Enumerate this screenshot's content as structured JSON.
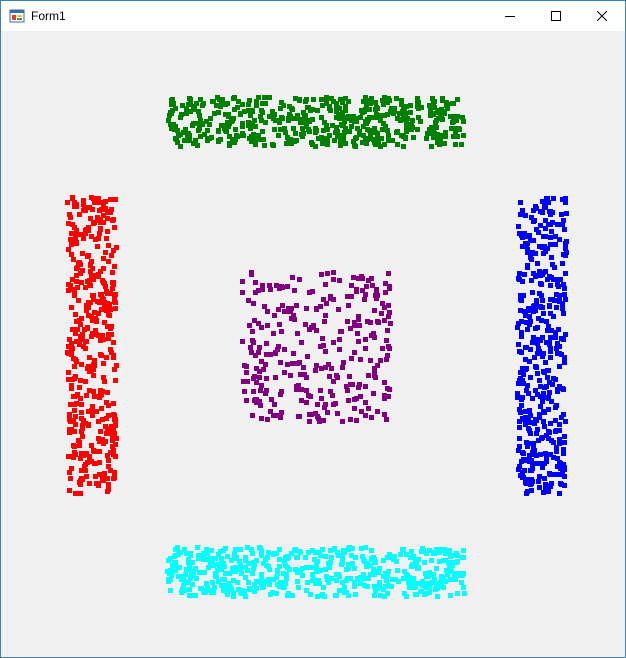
{
  "window": {
    "title": "Form1"
  },
  "caption_buttons": {
    "minimize_icon": "minimize-icon",
    "maximize_icon": "maximize-icon",
    "close_icon": "close-icon"
  },
  "clusters": [
    {
      "name": "green-cluster",
      "color": "#008000",
      "count": 520
    },
    {
      "name": "red-cluster",
      "color": "#ff0000",
      "count": 430
    },
    {
      "name": "purple-cluster",
      "color": "#800080",
      "count": 300
    },
    {
      "name": "blue-cluster",
      "color": "#0000ff",
      "count": 430
    },
    {
      "name": "cyan-cluster",
      "color": "#00ffff",
      "count": 520
    }
  ]
}
